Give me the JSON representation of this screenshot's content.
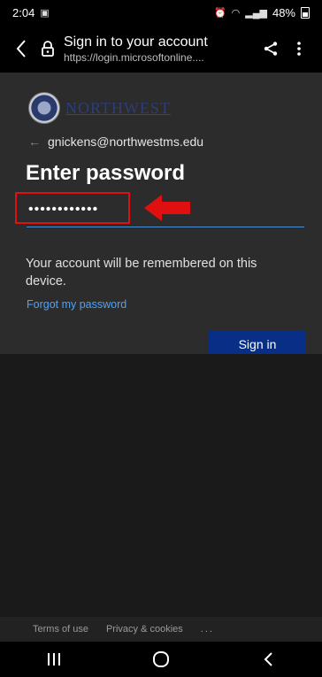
{
  "status_bar": {
    "time": "2:04",
    "battery": "48%"
  },
  "browser": {
    "title": "Sign in to your account",
    "url": "https://login.microsoftonline...."
  },
  "login": {
    "logo_text": "NORTHWEST",
    "account_email": "gnickens@northwestms.edu",
    "heading": "Enter password",
    "password_value": "••••••••••••",
    "remember_text": "Your account will be remembered on this device.",
    "forgot_link": "Forgot my password",
    "sign_in_label": "Sign in"
  },
  "footer": {
    "terms": "Terms of use",
    "privacy": "Privacy & cookies",
    "more": "..."
  },
  "colors": {
    "panel_bg": "#2c2c2c",
    "accent_blue": "#082f85",
    "link_blue": "#4aa3ff",
    "highlight_red": "#e01010"
  }
}
